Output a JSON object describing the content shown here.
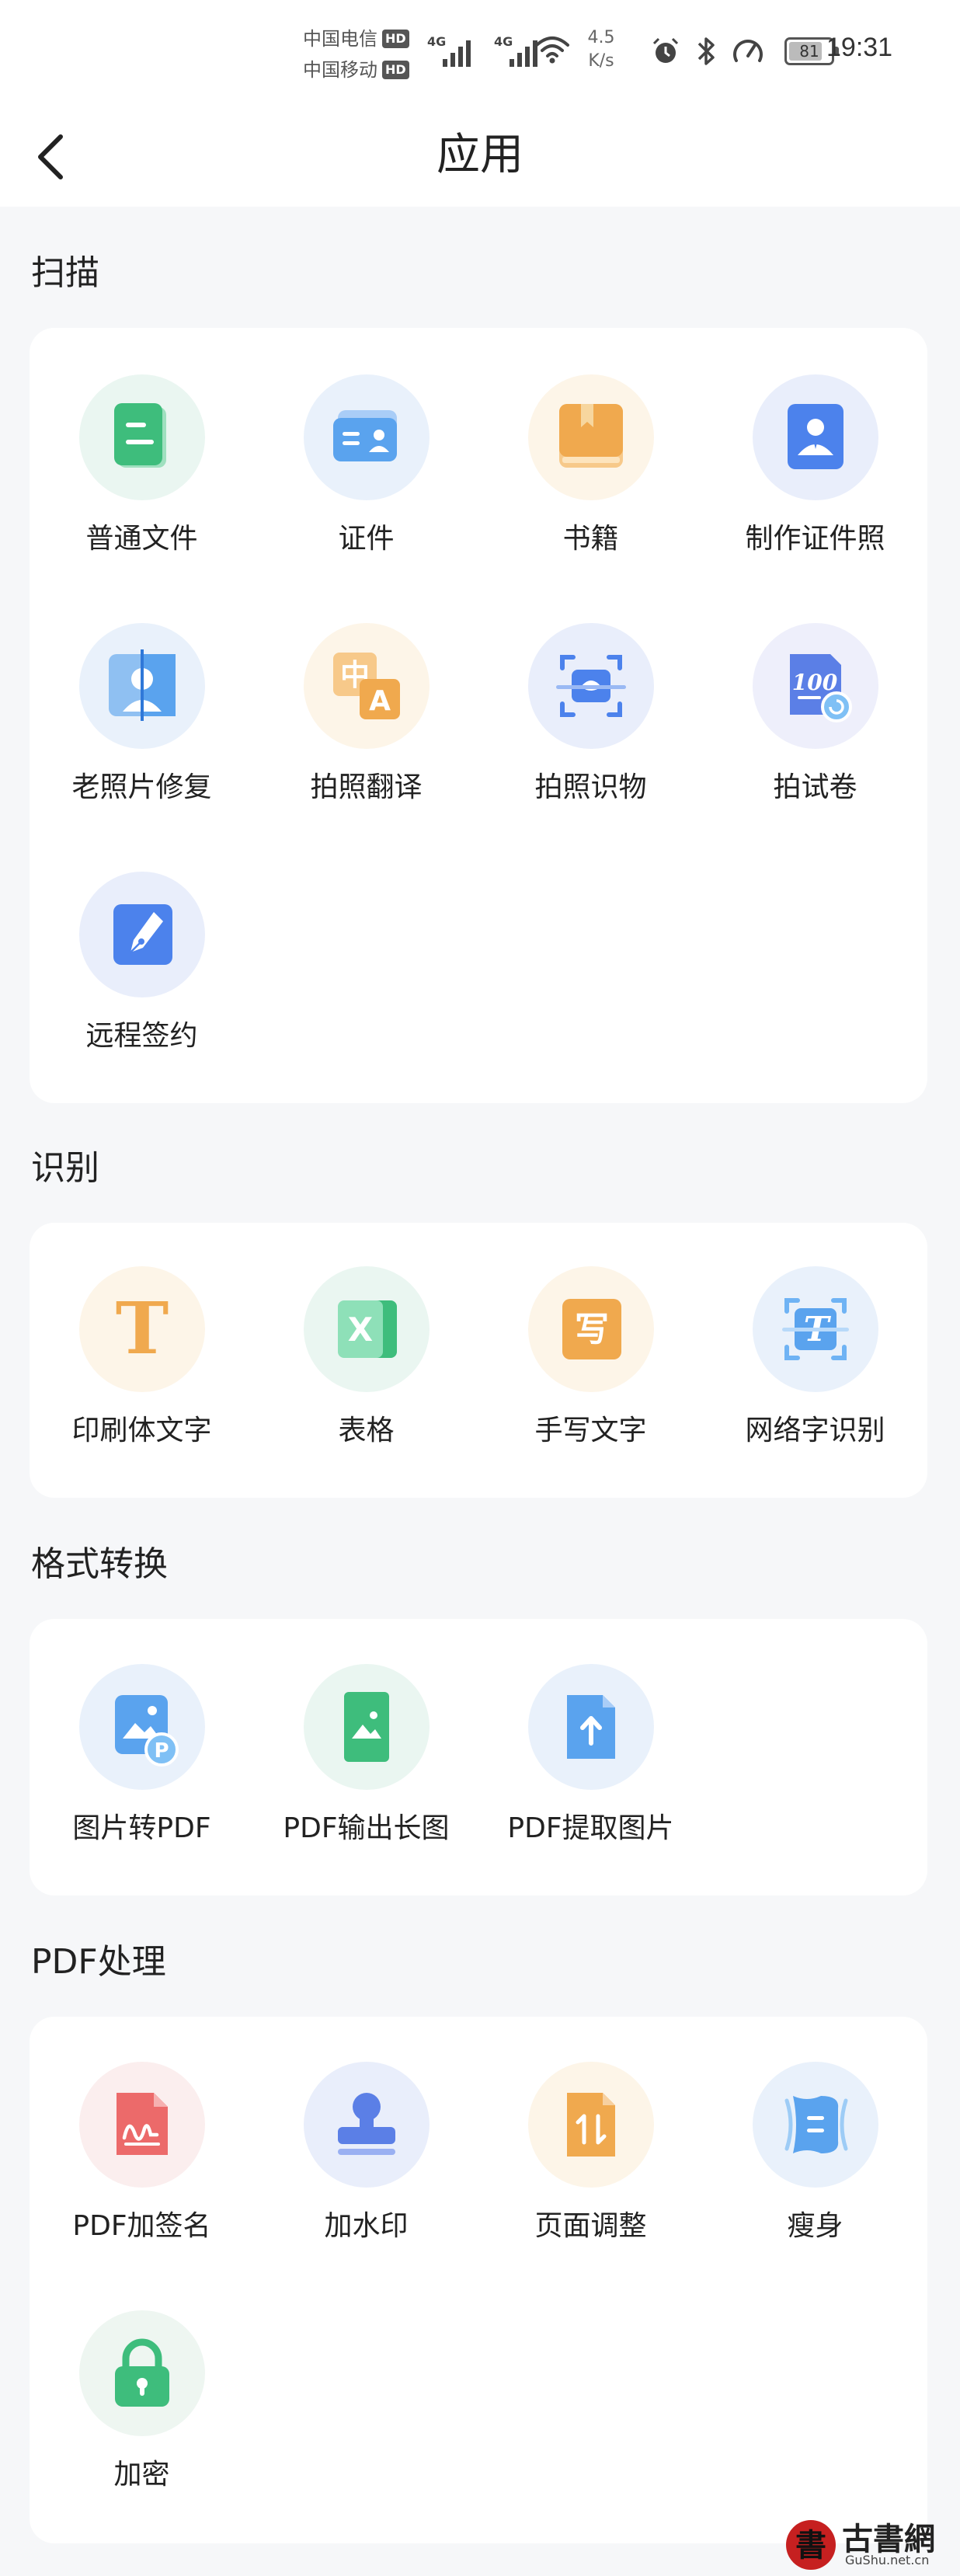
{
  "status_bar": {
    "carrier1": "中国电信",
    "carrier2": "中国移动",
    "hd_label": "HD",
    "network1": "4G",
    "network2": "4G",
    "speed_value": "4.5",
    "speed_unit": "K/s",
    "battery": "81",
    "battery_level": 0.81,
    "time": "19:31"
  },
  "header": {
    "title": "应用"
  },
  "sections": [
    {
      "title": "扫描",
      "items": [
        {
          "label": "普通文件",
          "icon": "document-icon"
        },
        {
          "label": "证件",
          "icon": "id-card-icon"
        },
        {
          "label": "书籍",
          "icon": "book-icon"
        },
        {
          "label": "制作证件照",
          "icon": "id-photo-icon"
        },
        {
          "label": "老照片修复",
          "icon": "photo-restore-icon"
        },
        {
          "label": "拍照翻译",
          "icon": "translate-icon"
        },
        {
          "label": "拍照识物",
          "icon": "object-recognition-icon"
        },
        {
          "label": "拍试卷",
          "icon": "test-paper-icon"
        },
        {
          "label": "远程签约",
          "icon": "pen-sign-icon"
        }
      ]
    },
    {
      "title": "识别",
      "items": [
        {
          "label": "印刷体文字",
          "icon": "print-text-icon",
          "glyph": "T"
        },
        {
          "label": "表格",
          "icon": "excel-icon",
          "glyph": "X"
        },
        {
          "label": "手写文字",
          "icon": "handwriting-icon",
          "glyph": "写"
        },
        {
          "label": "网络字识别",
          "icon": "network-text-icon",
          "glyph": "T"
        }
      ]
    },
    {
      "title": "格式转换",
      "items": [
        {
          "label": "图片转PDF",
          "icon": "image-to-pdf-icon",
          "glyph": "P"
        },
        {
          "label": "PDF输出长图",
          "icon": "pdf-long-image-icon"
        },
        {
          "label": "PDF提取图片",
          "icon": "pdf-extract-image-icon"
        }
      ]
    },
    {
      "title": "PDF处理",
      "items": [
        {
          "label": "PDF加签名",
          "icon": "pdf-signature-icon"
        },
        {
          "label": "加水印",
          "icon": "watermark-stamp-icon"
        },
        {
          "label": "页面调整",
          "icon": "page-adjust-icon"
        },
        {
          "label": "瘦身",
          "icon": "compress-icon"
        },
        {
          "label": "加密",
          "icon": "lock-icon"
        }
      ]
    }
  ],
  "watermark": {
    "glyph": "書",
    "name": "古書網",
    "url": "GuShu.net.cn"
  },
  "colors": {
    "accent_blue": "#4a86f0",
    "green": "#3fbf7f",
    "orange": "#f2a54a",
    "red": "#ec6a6a"
  }
}
